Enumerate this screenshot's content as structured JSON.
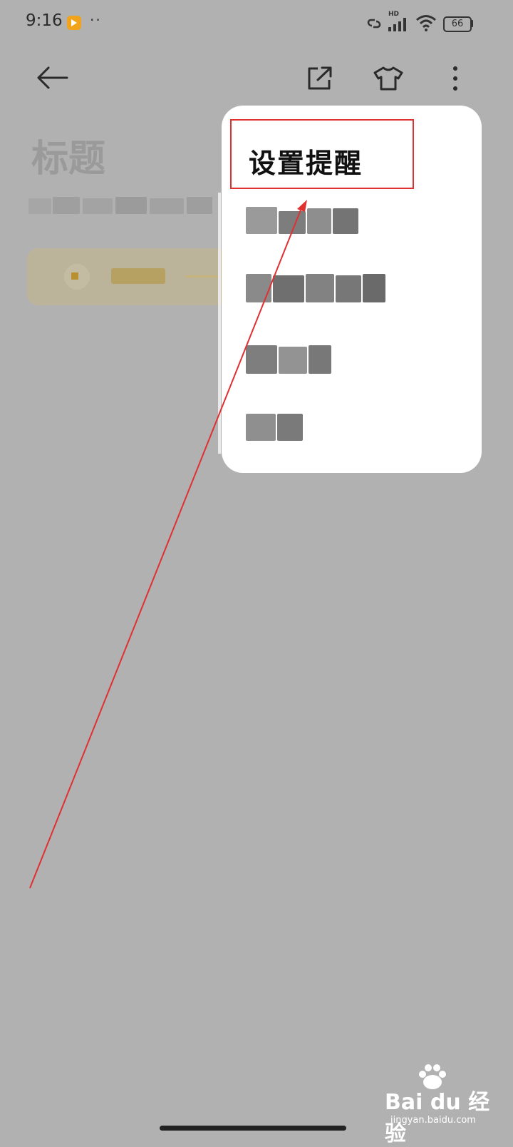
{
  "status_bar": {
    "time": "9:16",
    "dots": "··",
    "network_label": "HD",
    "battery": "66"
  },
  "toolbar": {
    "back_icon": "arrow-left-icon",
    "share_icon": "share-icon",
    "theme_icon": "tshirt-icon",
    "more_icon": "more-vertical-icon"
  },
  "note": {
    "title_placeholder": "标题"
  },
  "menu": {
    "items": [
      {
        "label": "设置提醒"
      }
    ]
  },
  "annotation": {
    "highlight_color": "#e03030"
  },
  "watermark": {
    "brand": "Bai du 经验",
    "url": "jingyan.baidu.com"
  },
  "colors": {
    "background": "#b1b1b1",
    "menu_background": "#ffffff",
    "accent_yellow": "#c9a84a"
  }
}
